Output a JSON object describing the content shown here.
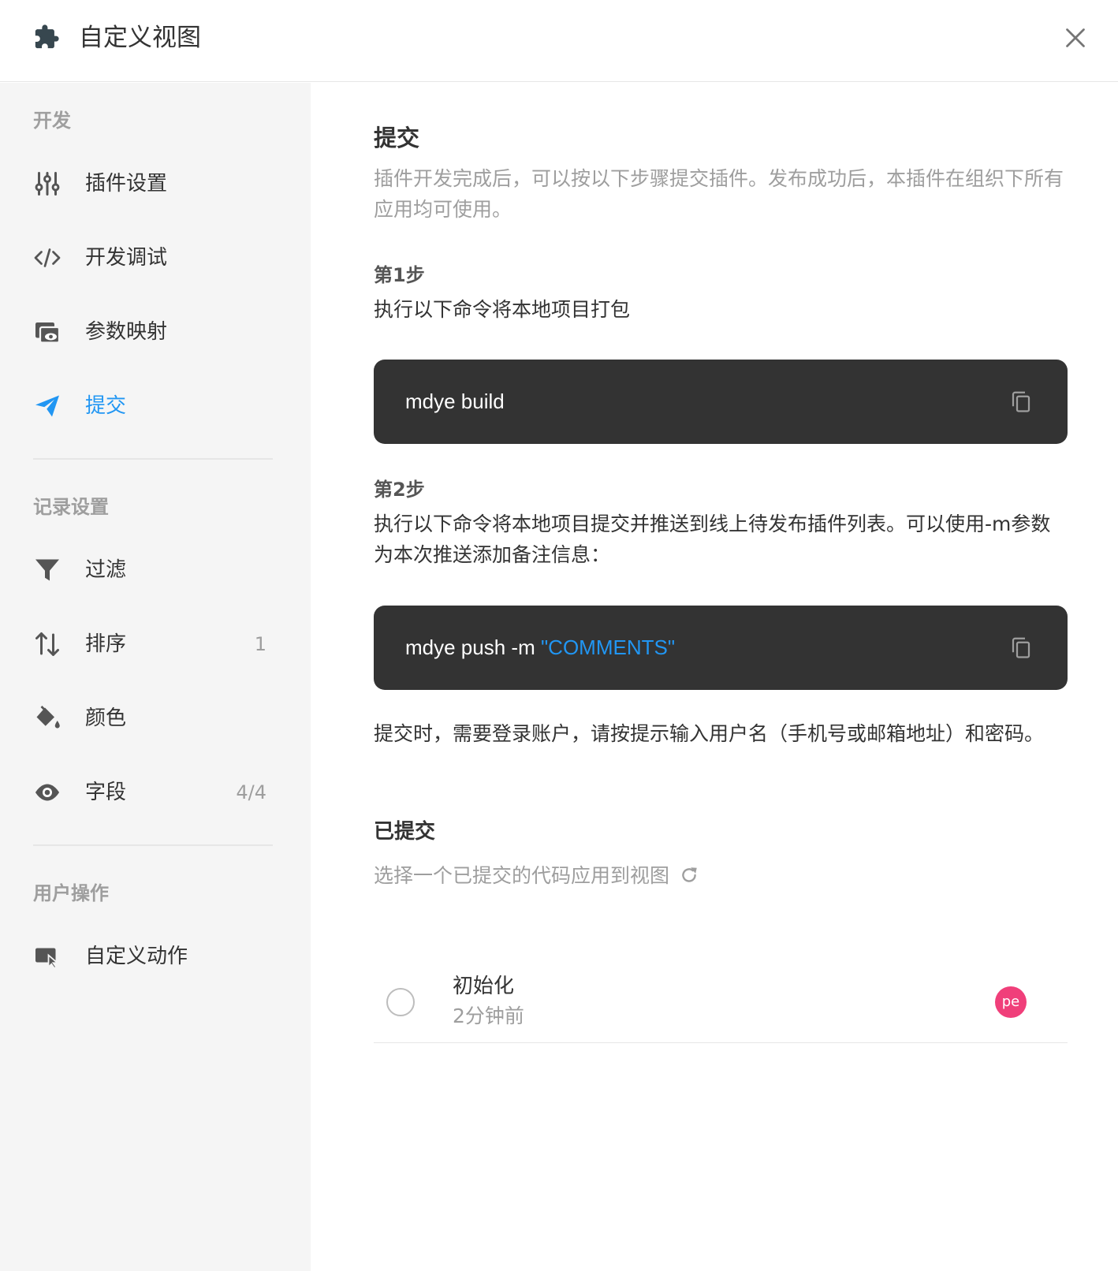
{
  "header": {
    "title": "自定义视图"
  },
  "sidebar": {
    "sections": [
      {
        "title": "开发",
        "items": [
          {
            "label": "插件设置",
            "icon": "sliders-icon"
          },
          {
            "label": "开发调试",
            "icon": "code-icon"
          },
          {
            "label": "参数映射",
            "icon": "param-mapping-icon"
          },
          {
            "label": "提交",
            "icon": "send-icon",
            "active": true
          }
        ]
      },
      {
        "title": "记录设置",
        "items": [
          {
            "label": "过滤",
            "icon": "filter-icon"
          },
          {
            "label": "排序",
            "icon": "sort-icon",
            "count": "1"
          },
          {
            "label": "颜色",
            "icon": "paint-bucket-icon"
          },
          {
            "label": "字段",
            "icon": "eye-icon",
            "count": "4/4"
          }
        ]
      },
      {
        "title": "用户操作",
        "items": [
          {
            "label": "自定义动作",
            "icon": "custom-action-icon"
          }
        ]
      }
    ]
  },
  "main": {
    "title": "提交",
    "description": "插件开发完成后，可以按以下步骤提交插件。发布成功后，本插件在组织下所有应用均可使用。",
    "step1": {
      "title": "第1步",
      "text": "执行以下命令将本地项目打包",
      "command": "mdye build"
    },
    "step2": {
      "title": "第2步",
      "text": "执行以下命令将本地项目提交并推送到线上待发布插件列表。可以使用-m参数为本次推送添加备注信息：",
      "command": "mdye push -m ",
      "command_arg": "\"COMMENTS\""
    },
    "note": "提交时，需要登录账户，请按提示输入用户名（手机号或邮箱地址）和密码。",
    "submitted": {
      "title": "已提交",
      "subtitle": "选择一个已提交的代码应用到视图",
      "commits": [
        {
          "name": "初始化",
          "time": "2分钟前",
          "avatar": "pe",
          "selected": false
        }
      ]
    }
  },
  "colors": {
    "accent": "#2196f3",
    "code_bg": "#333333",
    "sidebar_bg": "#f5f5f5",
    "avatar_bg": "#f03f7a"
  }
}
